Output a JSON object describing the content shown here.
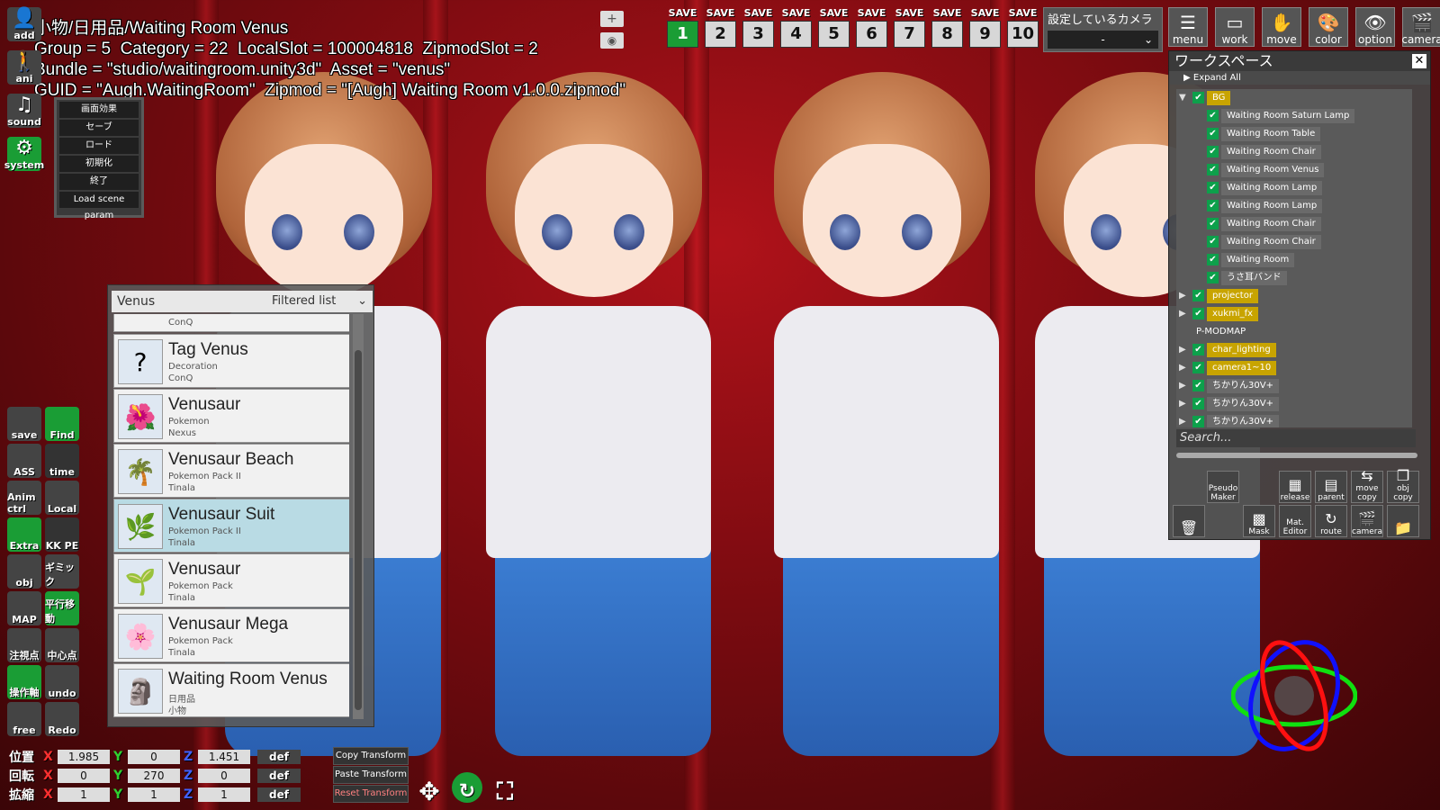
{
  "info_overlay": {
    "line1": "小物/日用品/Waiting Room Venus",
    "line2": "Group = 5  Category = 22  LocalSlot = 100004818  ZipmodSlot = 2",
    "line3": "Bundle = \"studio/waitingroom.unity3d\"  Asset = \"venus\"",
    "line4": "GUID = \"Augh.WaitingRoom\"  Zipmod = \"[Augh] Waiting Room v1.0.0.zipmod\""
  },
  "left_top_icons": {
    "add": "add",
    "anim": "ani",
    "sound": "sound",
    "system": "system"
  },
  "system_menu": [
    "画面効果",
    "セーブ",
    "ロード",
    "初期化",
    "終了",
    "Load scene param"
  ],
  "save_slots": {
    "label": "SAVE",
    "numbers": [
      "1",
      "2",
      "3",
      "4",
      "5",
      "6",
      "7",
      "8",
      "9",
      "10"
    ]
  },
  "camera_select": {
    "title": "設定しているカメラ",
    "value": "-"
  },
  "top_icons": [
    "menu",
    "work",
    "move",
    "color",
    "option",
    "camera"
  ],
  "workspace": {
    "title": "ワークスペース",
    "expand_all": "Expand All",
    "nodes": [
      {
        "label": "BG",
        "style": "y"
      },
      {
        "label": "Waiting Room Saturn Lamp"
      },
      {
        "label": "Waiting Room Table"
      },
      {
        "label": "Waiting Room Chair"
      },
      {
        "label": "Waiting Room Venus"
      },
      {
        "label": "Waiting Room Lamp"
      },
      {
        "label": "Waiting Room Lamp"
      },
      {
        "label": "Waiting Room Chair"
      },
      {
        "label": "Waiting Room Chair"
      },
      {
        "label": "Waiting Room"
      },
      {
        "label": "うさ耳バンド"
      },
      {
        "label": "projector",
        "style": "y"
      },
      {
        "label": "xukmi_fx",
        "style": "y"
      },
      {
        "label": "P-MODMAP",
        "style": "plain"
      },
      {
        "label": "char_lighting",
        "style": "y"
      },
      {
        "label": "camera1~10",
        "style": "y"
      },
      {
        "label": "ちかりん30V+"
      },
      {
        "label": "ちかりん30V+"
      },
      {
        "label": "ちかりん30V+"
      }
    ],
    "search_placeholder": "Search...",
    "buttons": {
      "pseudo_maker": "Pseudo Maker",
      "release": "release",
      "parent": "parent",
      "move_copy": "move copy",
      "obj_copy": "obj copy",
      "mask": "Mask",
      "mat_editor": "Mat. Editor",
      "route": "route",
      "camera": "camera"
    }
  },
  "filter_panel": {
    "search_value": "Venus",
    "dropdown": "Filtered list",
    "partial_top": "ConQ",
    "items": [
      {
        "name": "Tag Venus",
        "cat": "Decoration",
        "author": "ConQ",
        "icon": "?"
      },
      {
        "name": "Venusaur",
        "cat": "Pokemon",
        "author": "Nexus",
        "icon": "🌺"
      },
      {
        "name": "Venusaur Beach",
        "cat": "Pokemon Pack II",
        "author": "Tinala",
        "icon": "🌴"
      },
      {
        "name": "Venusaur Suit",
        "cat": "Pokemon Pack II",
        "author": "Tinala",
        "icon": "🌿",
        "selected": true
      },
      {
        "name": "Venusaur",
        "cat": "Pokemon Pack",
        "author": "Tinala",
        "icon": "🌱"
      },
      {
        "name": "Venusaur Mega",
        "cat": "Pokemon Pack",
        "author": "Tinala",
        "icon": "🌸"
      },
      {
        "name": "Waiting Room Venus",
        "cat": "日用品",
        "author": "小物",
        "icon": "🗿"
      }
    ]
  },
  "left_tools": [
    [
      "save",
      "Find"
    ],
    [
      "ASS",
      "time"
    ],
    [
      "Anim ctrl",
      "Local"
    ],
    [
      "Extra",
      "KK PE"
    ],
    [
      "obj",
      "ギミック"
    ],
    [
      "MAP",
      "平行移動"
    ],
    [
      "注視点",
      "中心点"
    ],
    [
      "操作軸",
      "undo"
    ],
    [
      "free",
      "Redo"
    ]
  ],
  "transform": {
    "pos_label": "位置",
    "rot_label": "回転",
    "scale_label": "拡縮",
    "pos": [
      "1.985",
      "0",
      "1.451"
    ],
    "rot": [
      "0",
      "270",
      "0"
    ],
    "scale": [
      "1",
      "1",
      "1"
    ],
    "def": "def",
    "copy": "Copy Transform",
    "paste": "Paste Transform",
    "reset": "Reset Transform"
  }
}
